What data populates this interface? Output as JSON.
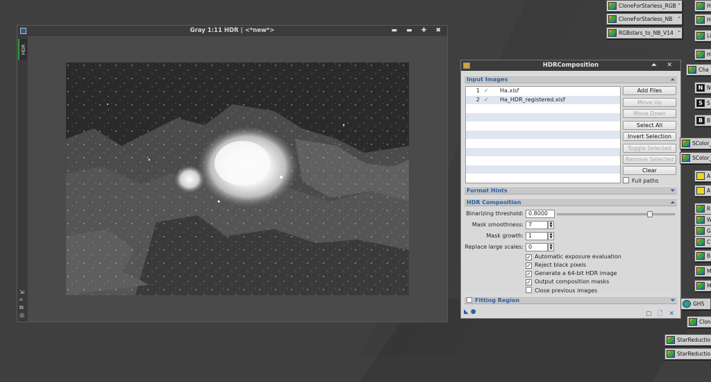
{
  "image_window": {
    "title": "Gray 1:11 HDR | <*new*>",
    "controls": "▬ ▬ ✚ ✖",
    "side_tab": "HDR",
    "side_tools": [
      "⇲",
      "⌗",
      "⧉",
      "◎"
    ]
  },
  "dialog": {
    "title": "HDRComposition",
    "title_controls": "⏶ ✕",
    "sections": {
      "input_images": "Input Images",
      "format_hints": "Format Hints",
      "hdr_composition": "HDR Composition",
      "fitting_region": "Fitting Region"
    },
    "files": [
      {
        "index": "1",
        "check": "✓",
        "name": "Ha.xisf"
      },
      {
        "index": "2",
        "check": "✓",
        "name": "Ha_HDR_registered.xisf"
      }
    ],
    "buttons": {
      "add_files": "Add Files",
      "move_up": "Move Up",
      "move_down": "Move Down",
      "select_all": "Select All",
      "invert_selection": "Invert Selection",
      "toggle_selected": "Toggle Selected",
      "remove_selected": "Remove Selected",
      "clear": "Clear"
    },
    "full_paths": "Full paths",
    "params": {
      "binarizing_threshold_label": "Binarizing threshold:",
      "binarizing_threshold": "0.8000",
      "binarizing_threshold_slider": 0.8,
      "mask_smoothness_label": "Mask smoothness:",
      "mask_smoothness": "7",
      "mask_growth_label": "Mask growth:",
      "mask_growth": "1",
      "replace_large_scales_label": "Replace large scales:",
      "replace_large_scales": "0"
    },
    "options": [
      {
        "label": "Automatic exposure evaluation",
        "checked": true
      },
      {
        "label": "Reject black pixels",
        "checked": true
      },
      {
        "label": "Generate a 64-bit HDR image",
        "checked": true
      },
      {
        "label": "Output composition masks",
        "checked": true
      },
      {
        "label": "Close previous images",
        "checked": false
      }
    ],
    "footer_left": "◣ ●",
    "footer_right": "▢ 🗋 ✕"
  },
  "process_icons": [
    {
      "label": "CloneForStarless_RGB",
      "icon": "gradient",
      "suffix": "\""
    },
    {
      "label": "CloneForStarless_NB",
      "icon": "gradient",
      "suffix": "\""
    },
    {
      "label": "RGBstars_to_NB_V14",
      "icon": "gradient",
      "suffix": "\""
    },
    {
      "label": "H",
      "icon": "gradient"
    },
    {
      "label": "H",
      "icon": "gradient"
    },
    {
      "label": "Li",
      "icon": "gradient"
    },
    {
      "label": "H",
      "icon": "gradient"
    },
    {
      "label": "Cha",
      "icon": "gradient"
    },
    {
      "label": "N",
      "icon": "letter",
      "letter": "N"
    },
    {
      "label": "S",
      "icon": "letter",
      "letter": "S"
    },
    {
      "label": "B",
      "icon": "letter",
      "letter": "B"
    },
    {
      "label": "SColor_c",
      "icon": "gradient"
    },
    {
      "label": "SColor_c",
      "icon": "gradient"
    },
    {
      "label": "A",
      "icon": "yellow"
    },
    {
      "label": "A",
      "icon": "yellow"
    },
    {
      "label": "R",
      "icon": "gradient"
    },
    {
      "label": "W",
      "icon": "gradient"
    },
    {
      "label": "G",
      "icon": "gradient"
    },
    {
      "label": "C",
      "icon": "gradient"
    },
    {
      "label": "B",
      "icon": "gradient"
    },
    {
      "label": "M",
      "icon": "gradient"
    },
    {
      "label": "M",
      "icon": "gradient"
    },
    {
      "label": "GHS",
      "icon": "teal"
    },
    {
      "label": "Clon",
      "icon": "gradient"
    },
    {
      "label": "StarReductio",
      "icon": "gradient"
    },
    {
      "label": "StarReductio",
      "icon": "gradient"
    }
  ]
}
